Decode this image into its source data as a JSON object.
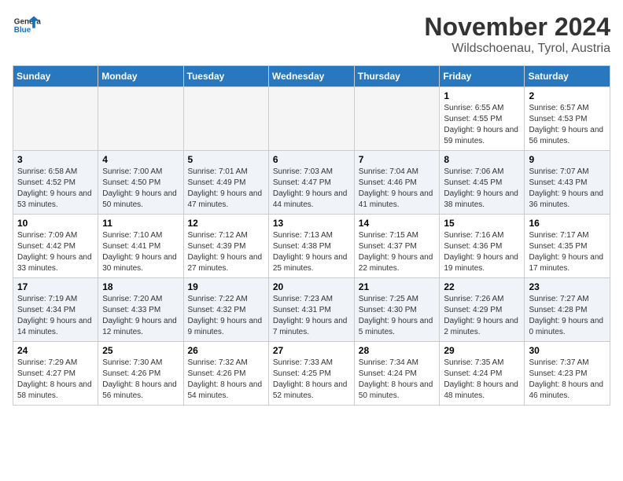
{
  "header": {
    "logo_general": "General",
    "logo_blue": "Blue",
    "month_title": "November 2024",
    "location": "Wildschoenau, Tyrol, Austria"
  },
  "weekdays": [
    "Sunday",
    "Monday",
    "Tuesday",
    "Wednesday",
    "Thursday",
    "Friday",
    "Saturday"
  ],
  "weeks": [
    [
      {
        "day": "",
        "info": ""
      },
      {
        "day": "",
        "info": ""
      },
      {
        "day": "",
        "info": ""
      },
      {
        "day": "",
        "info": ""
      },
      {
        "day": "",
        "info": ""
      },
      {
        "day": "1",
        "info": "Sunrise: 6:55 AM\nSunset: 4:55 PM\nDaylight: 9 hours and 59 minutes."
      },
      {
        "day": "2",
        "info": "Sunrise: 6:57 AM\nSunset: 4:53 PM\nDaylight: 9 hours and 56 minutes."
      }
    ],
    [
      {
        "day": "3",
        "info": "Sunrise: 6:58 AM\nSunset: 4:52 PM\nDaylight: 9 hours and 53 minutes."
      },
      {
        "day": "4",
        "info": "Sunrise: 7:00 AM\nSunset: 4:50 PM\nDaylight: 9 hours and 50 minutes."
      },
      {
        "day": "5",
        "info": "Sunrise: 7:01 AM\nSunset: 4:49 PM\nDaylight: 9 hours and 47 minutes."
      },
      {
        "day": "6",
        "info": "Sunrise: 7:03 AM\nSunset: 4:47 PM\nDaylight: 9 hours and 44 minutes."
      },
      {
        "day": "7",
        "info": "Sunrise: 7:04 AM\nSunset: 4:46 PM\nDaylight: 9 hours and 41 minutes."
      },
      {
        "day": "8",
        "info": "Sunrise: 7:06 AM\nSunset: 4:45 PM\nDaylight: 9 hours and 38 minutes."
      },
      {
        "day": "9",
        "info": "Sunrise: 7:07 AM\nSunset: 4:43 PM\nDaylight: 9 hours and 36 minutes."
      }
    ],
    [
      {
        "day": "10",
        "info": "Sunrise: 7:09 AM\nSunset: 4:42 PM\nDaylight: 9 hours and 33 minutes."
      },
      {
        "day": "11",
        "info": "Sunrise: 7:10 AM\nSunset: 4:41 PM\nDaylight: 9 hours and 30 minutes."
      },
      {
        "day": "12",
        "info": "Sunrise: 7:12 AM\nSunset: 4:39 PM\nDaylight: 9 hours and 27 minutes."
      },
      {
        "day": "13",
        "info": "Sunrise: 7:13 AM\nSunset: 4:38 PM\nDaylight: 9 hours and 25 minutes."
      },
      {
        "day": "14",
        "info": "Sunrise: 7:15 AM\nSunset: 4:37 PM\nDaylight: 9 hours and 22 minutes."
      },
      {
        "day": "15",
        "info": "Sunrise: 7:16 AM\nSunset: 4:36 PM\nDaylight: 9 hours and 19 minutes."
      },
      {
        "day": "16",
        "info": "Sunrise: 7:17 AM\nSunset: 4:35 PM\nDaylight: 9 hours and 17 minutes."
      }
    ],
    [
      {
        "day": "17",
        "info": "Sunrise: 7:19 AM\nSunset: 4:34 PM\nDaylight: 9 hours and 14 minutes."
      },
      {
        "day": "18",
        "info": "Sunrise: 7:20 AM\nSunset: 4:33 PM\nDaylight: 9 hours and 12 minutes."
      },
      {
        "day": "19",
        "info": "Sunrise: 7:22 AM\nSunset: 4:32 PM\nDaylight: 9 hours and 9 minutes."
      },
      {
        "day": "20",
        "info": "Sunrise: 7:23 AM\nSunset: 4:31 PM\nDaylight: 9 hours and 7 minutes."
      },
      {
        "day": "21",
        "info": "Sunrise: 7:25 AM\nSunset: 4:30 PM\nDaylight: 9 hours and 5 minutes."
      },
      {
        "day": "22",
        "info": "Sunrise: 7:26 AM\nSunset: 4:29 PM\nDaylight: 9 hours and 2 minutes."
      },
      {
        "day": "23",
        "info": "Sunrise: 7:27 AM\nSunset: 4:28 PM\nDaylight: 9 hours and 0 minutes."
      }
    ],
    [
      {
        "day": "24",
        "info": "Sunrise: 7:29 AM\nSunset: 4:27 PM\nDaylight: 8 hours and 58 minutes."
      },
      {
        "day": "25",
        "info": "Sunrise: 7:30 AM\nSunset: 4:26 PM\nDaylight: 8 hours and 56 minutes."
      },
      {
        "day": "26",
        "info": "Sunrise: 7:32 AM\nSunset: 4:26 PM\nDaylight: 8 hours and 54 minutes."
      },
      {
        "day": "27",
        "info": "Sunrise: 7:33 AM\nSunset: 4:25 PM\nDaylight: 8 hours and 52 minutes."
      },
      {
        "day": "28",
        "info": "Sunrise: 7:34 AM\nSunset: 4:24 PM\nDaylight: 8 hours and 50 minutes."
      },
      {
        "day": "29",
        "info": "Sunrise: 7:35 AM\nSunset: 4:24 PM\nDaylight: 8 hours and 48 minutes."
      },
      {
        "day": "30",
        "info": "Sunrise: 7:37 AM\nSunset: 4:23 PM\nDaylight: 8 hours and 46 minutes."
      }
    ]
  ]
}
